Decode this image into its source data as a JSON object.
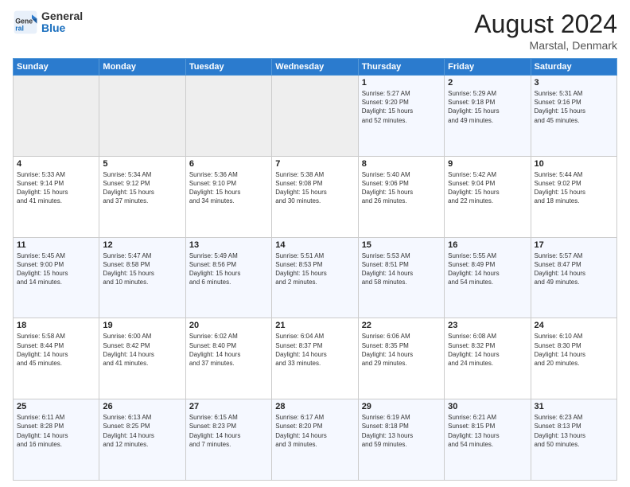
{
  "header": {
    "logo_general": "General",
    "logo_blue": "Blue",
    "month_year": "August 2024",
    "location": "Marstal, Denmark"
  },
  "weekdays": [
    "Sunday",
    "Monday",
    "Tuesday",
    "Wednesday",
    "Thursday",
    "Friday",
    "Saturday"
  ],
  "weeks": [
    [
      {
        "day": "",
        "info": ""
      },
      {
        "day": "",
        "info": ""
      },
      {
        "day": "",
        "info": ""
      },
      {
        "day": "",
        "info": ""
      },
      {
        "day": "1",
        "info": "Sunrise: 5:27 AM\nSunset: 9:20 PM\nDaylight: 15 hours\nand 52 minutes."
      },
      {
        "day": "2",
        "info": "Sunrise: 5:29 AM\nSunset: 9:18 PM\nDaylight: 15 hours\nand 49 minutes."
      },
      {
        "day": "3",
        "info": "Sunrise: 5:31 AM\nSunset: 9:16 PM\nDaylight: 15 hours\nand 45 minutes."
      }
    ],
    [
      {
        "day": "4",
        "info": "Sunrise: 5:33 AM\nSunset: 9:14 PM\nDaylight: 15 hours\nand 41 minutes."
      },
      {
        "day": "5",
        "info": "Sunrise: 5:34 AM\nSunset: 9:12 PM\nDaylight: 15 hours\nand 37 minutes."
      },
      {
        "day": "6",
        "info": "Sunrise: 5:36 AM\nSunset: 9:10 PM\nDaylight: 15 hours\nand 34 minutes."
      },
      {
        "day": "7",
        "info": "Sunrise: 5:38 AM\nSunset: 9:08 PM\nDaylight: 15 hours\nand 30 minutes."
      },
      {
        "day": "8",
        "info": "Sunrise: 5:40 AM\nSunset: 9:06 PM\nDaylight: 15 hours\nand 26 minutes."
      },
      {
        "day": "9",
        "info": "Sunrise: 5:42 AM\nSunset: 9:04 PM\nDaylight: 15 hours\nand 22 minutes."
      },
      {
        "day": "10",
        "info": "Sunrise: 5:44 AM\nSunset: 9:02 PM\nDaylight: 15 hours\nand 18 minutes."
      }
    ],
    [
      {
        "day": "11",
        "info": "Sunrise: 5:45 AM\nSunset: 9:00 PM\nDaylight: 15 hours\nand 14 minutes."
      },
      {
        "day": "12",
        "info": "Sunrise: 5:47 AM\nSunset: 8:58 PM\nDaylight: 15 hours\nand 10 minutes."
      },
      {
        "day": "13",
        "info": "Sunrise: 5:49 AM\nSunset: 8:56 PM\nDaylight: 15 hours\nand 6 minutes."
      },
      {
        "day": "14",
        "info": "Sunrise: 5:51 AM\nSunset: 8:53 PM\nDaylight: 15 hours\nand 2 minutes."
      },
      {
        "day": "15",
        "info": "Sunrise: 5:53 AM\nSunset: 8:51 PM\nDaylight: 14 hours\nand 58 minutes."
      },
      {
        "day": "16",
        "info": "Sunrise: 5:55 AM\nSunset: 8:49 PM\nDaylight: 14 hours\nand 54 minutes."
      },
      {
        "day": "17",
        "info": "Sunrise: 5:57 AM\nSunset: 8:47 PM\nDaylight: 14 hours\nand 49 minutes."
      }
    ],
    [
      {
        "day": "18",
        "info": "Sunrise: 5:58 AM\nSunset: 8:44 PM\nDaylight: 14 hours\nand 45 minutes."
      },
      {
        "day": "19",
        "info": "Sunrise: 6:00 AM\nSunset: 8:42 PM\nDaylight: 14 hours\nand 41 minutes."
      },
      {
        "day": "20",
        "info": "Sunrise: 6:02 AM\nSunset: 8:40 PM\nDaylight: 14 hours\nand 37 minutes."
      },
      {
        "day": "21",
        "info": "Sunrise: 6:04 AM\nSunset: 8:37 PM\nDaylight: 14 hours\nand 33 minutes."
      },
      {
        "day": "22",
        "info": "Sunrise: 6:06 AM\nSunset: 8:35 PM\nDaylight: 14 hours\nand 29 minutes."
      },
      {
        "day": "23",
        "info": "Sunrise: 6:08 AM\nSunset: 8:32 PM\nDaylight: 14 hours\nand 24 minutes."
      },
      {
        "day": "24",
        "info": "Sunrise: 6:10 AM\nSunset: 8:30 PM\nDaylight: 14 hours\nand 20 minutes."
      }
    ],
    [
      {
        "day": "25",
        "info": "Sunrise: 6:11 AM\nSunset: 8:28 PM\nDaylight: 14 hours\nand 16 minutes."
      },
      {
        "day": "26",
        "info": "Sunrise: 6:13 AM\nSunset: 8:25 PM\nDaylight: 14 hours\nand 12 minutes."
      },
      {
        "day": "27",
        "info": "Sunrise: 6:15 AM\nSunset: 8:23 PM\nDaylight: 14 hours\nand 7 minutes."
      },
      {
        "day": "28",
        "info": "Sunrise: 6:17 AM\nSunset: 8:20 PM\nDaylight: 14 hours\nand 3 minutes."
      },
      {
        "day": "29",
        "info": "Sunrise: 6:19 AM\nSunset: 8:18 PM\nDaylight: 13 hours\nand 59 minutes."
      },
      {
        "day": "30",
        "info": "Sunrise: 6:21 AM\nSunset: 8:15 PM\nDaylight: 13 hours\nand 54 minutes."
      },
      {
        "day": "31",
        "info": "Sunrise: 6:23 AM\nSunset: 8:13 PM\nDaylight: 13 hours\nand 50 minutes."
      }
    ]
  ]
}
